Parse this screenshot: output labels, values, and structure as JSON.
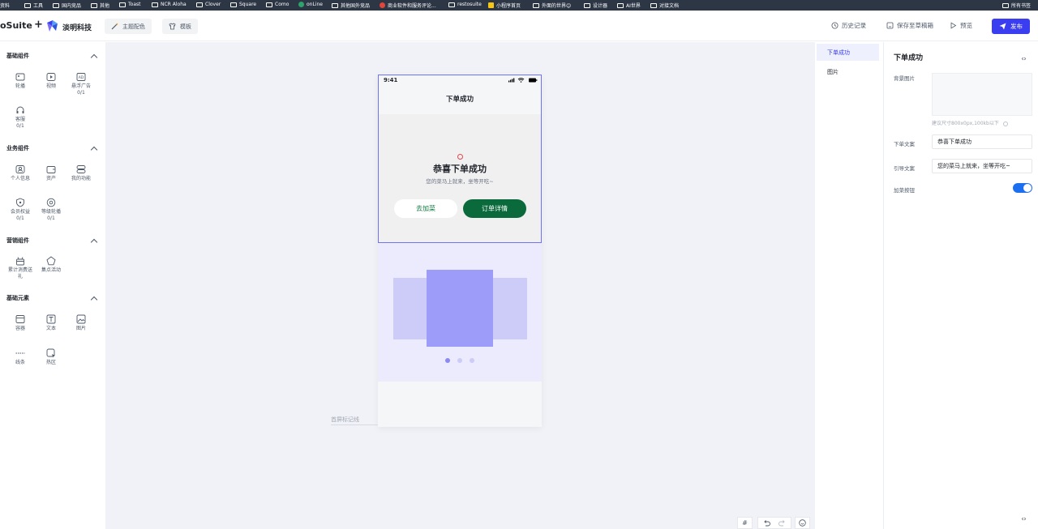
{
  "bookmarks": [
    "资料",
    "工具",
    "国内竞品",
    "其他",
    "Toast",
    "NCR Aloha",
    "Clover",
    "Square",
    "Como",
    "onLine",
    "其他国外竞品",
    "商业软件和服务评论...",
    "restosuite",
    "小程序首页",
    "外面的世界😊",
    "设计器",
    "AI世界",
    "对接文档",
    "所有书签"
  ],
  "header": {
    "brand": "oSuite",
    "plus": "+",
    "company": "淡明科技",
    "theme_label": "主题配色",
    "template_label": "模板",
    "history_label": "历史记录",
    "save_draft_label": "保存至草稿箱",
    "preview_label": "预览",
    "publish_label": "发布"
  },
  "sidebar": {
    "sections": [
      {
        "title": "基础组件",
        "items": [
          {
            "label": "轮播"
          },
          {
            "label": "视频"
          },
          {
            "label": "悬浮广告",
            "count": "0/1"
          },
          {
            "label": "客服",
            "count": "0/1"
          }
        ]
      },
      {
        "title": "业务组件",
        "items": [
          {
            "label": "个人信息"
          },
          {
            "label": "资产"
          },
          {
            "label": "我的功能"
          },
          {
            "label": "会员权益",
            "count": "0/1"
          },
          {
            "label": "等级轮播",
            "count": "0/1"
          }
        ]
      },
      {
        "title": "营销组件",
        "items": [
          {
            "label": "累计消费送礼"
          },
          {
            "label": "集点活动"
          }
        ]
      },
      {
        "title": "基础元素",
        "items": [
          {
            "label": "容器"
          },
          {
            "label": "文本"
          },
          {
            "label": "图片"
          },
          {
            "label": "线条"
          },
          {
            "label": "热区"
          }
        ]
      }
    ]
  },
  "phone": {
    "time": "9:41",
    "nav_title": "下单成功",
    "success_title": "恭喜下单成功",
    "success_subtitle": "您的菜马上就来，坐等开吃~",
    "add_dish_button": "去加菜",
    "order_detail_button": "订单详情"
  },
  "canvas": {
    "first_screen_label": "首屏标记线"
  },
  "layers": [
    "下单成功",
    "图片"
  ],
  "props": {
    "title": "下单成功",
    "bg_label": "背景图片",
    "bg_hint": "建议尺寸800x0px,100kb以下",
    "order_text_label": "下单文案",
    "order_text_value": "恭喜下单成功",
    "guide_text_label": "引导文案",
    "guide_text_value": "您的菜马上就来，坐等开吃~",
    "add_button_label": "加菜按钮",
    "add_button_enabled": true
  }
}
